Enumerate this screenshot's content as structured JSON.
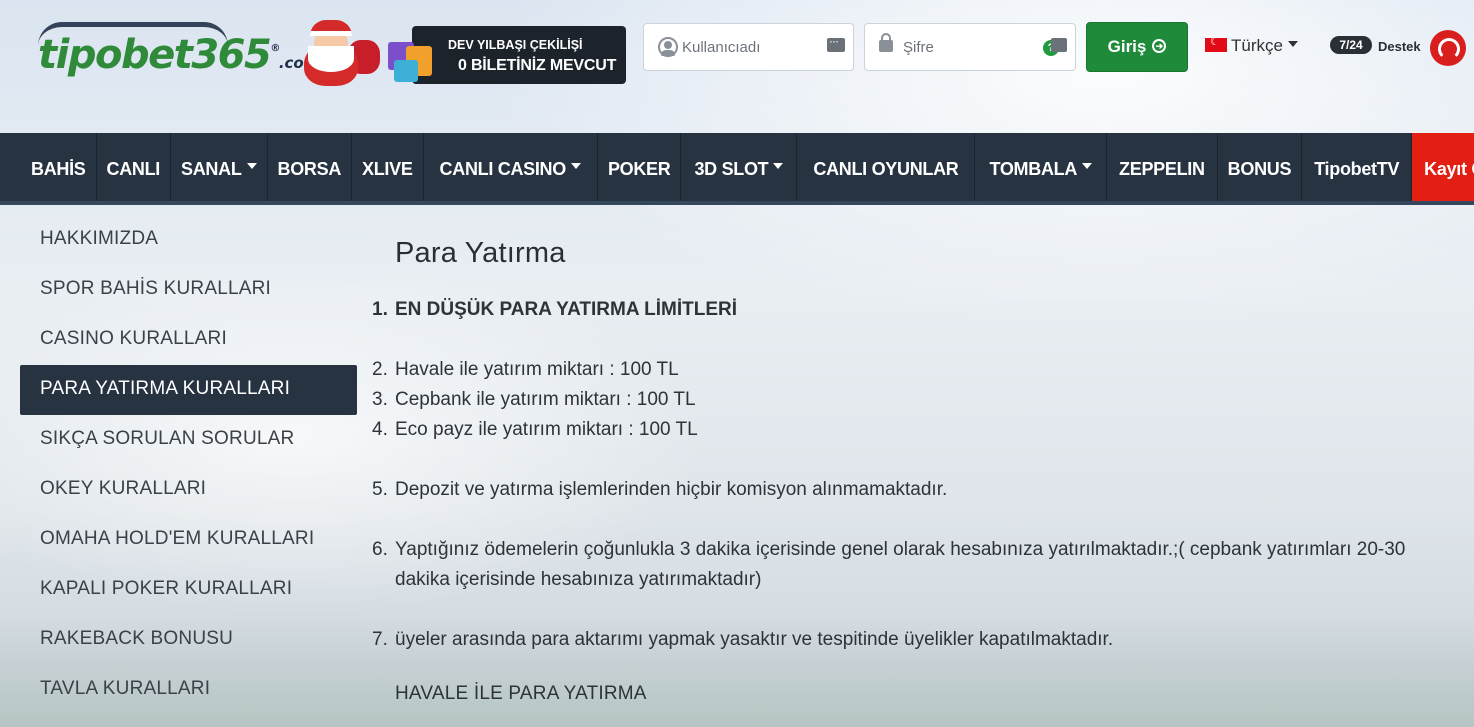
{
  "header": {
    "logo_text": "tipobet365",
    "logo_reg": "®",
    "logo_suffix": ".com",
    "lottery_line1": "DEV YILBAŞI ÇEKİLİŞİ",
    "lottery_line2": "0 BİLETİNİZ MEVCUT",
    "username_placeholder": "Kullanıcıadı",
    "password_placeholder": "Şifre",
    "login_label": "Giriş",
    "language": "Türkçe",
    "support_badge": "7/24",
    "support_label": "Destek"
  },
  "nav": {
    "items": [
      {
        "label": "BAHİS"
      },
      {
        "label": "CANLI"
      },
      {
        "label": "SANAL"
      },
      {
        "label": "BORSA"
      },
      {
        "label": "XLIVE"
      },
      {
        "label": "CANLI CASINO"
      },
      {
        "label": "POKER"
      },
      {
        "label": "3D SLOT"
      },
      {
        "label": "CANLI OYUNLAR"
      },
      {
        "label": "TOMBALA"
      },
      {
        "label": "ZEPPELIN"
      },
      {
        "label": "BONUS"
      },
      {
        "label": "TipobetTV"
      },
      {
        "label": "Kayıt Ol"
      }
    ]
  },
  "sidebar": {
    "items": [
      {
        "label": "HAKKIMIZDA"
      },
      {
        "label": "SPOR BAHİS KURALLARI"
      },
      {
        "label": "CASINO KURALLARI"
      },
      {
        "label": "PARA YATIRMA KURALLARI"
      },
      {
        "label": "SIKÇA SORULAN SORULAR"
      },
      {
        "label": "OKEY KURALLARI"
      },
      {
        "label": "OMAHA HOLD'EM KURALLARI"
      },
      {
        "label": "KAPALI POKER KURALLARI"
      },
      {
        "label": "RAKEBACK BONUSU"
      },
      {
        "label": "TAVLA KURALLARI"
      }
    ]
  },
  "content": {
    "title": "Para Yatırma",
    "items": [
      {
        "num": "1.",
        "text": "EN DÜŞÜK PARA YATIRMA LİMİTLERİ"
      },
      {
        "num": "2.",
        "text": "Havale ile yatırım miktarı : 100 TL"
      },
      {
        "num": "3.",
        "text": "Cepbank ile yatırım miktarı : 100 TL"
      },
      {
        "num": "4.",
        "text": "Eco payz ile yatırım miktarı : 100 TL"
      },
      {
        "num": "5.",
        "text": "Depozit ve yatırma işlemlerinden hiçbir komisyon alınmamaktadır."
      },
      {
        "num": "6.",
        "text": "Yaptığınız ödemelerin çoğunlukla 3 dakika içerisinde genel olarak hesabınıza yatırılmaktadır.;( cepbank yatırımları 20-30 dakika içerisinde hesabınıza yatırımaktadır)"
      },
      {
        "num": "7.",
        "text": "üyeler arasında para aktarımı yapmak yasaktır ve tespitinde üyelikler kapatılmaktadır."
      }
    ],
    "subheading": "HAVALE İLE PARA YATIRMA"
  }
}
